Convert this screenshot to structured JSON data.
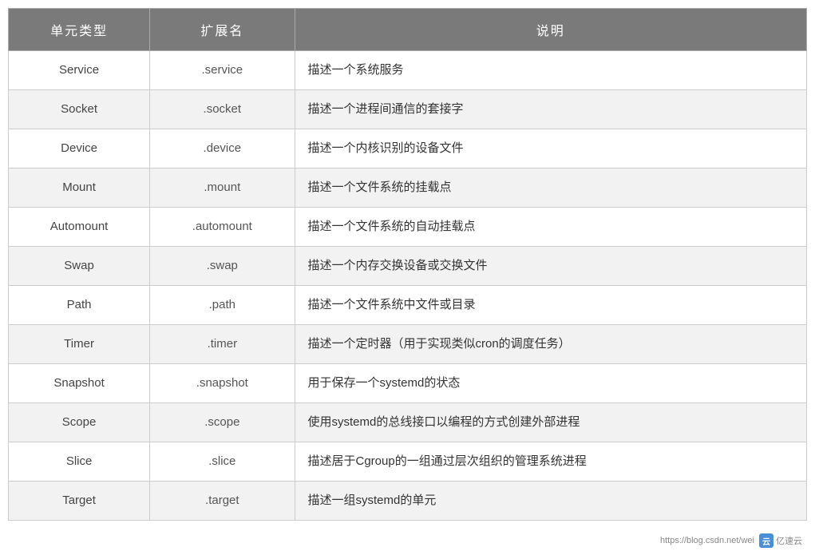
{
  "table": {
    "headers": [
      "单元类型",
      "扩展名",
      "说明"
    ],
    "rows": [
      {
        "type": "Service",
        "ext": ".service",
        "desc": "描述一个系统服务"
      },
      {
        "type": "Socket",
        "ext": ".socket",
        "desc": "描述一个进程间通信的套接字"
      },
      {
        "type": "Device",
        "ext": ".device",
        "desc": "描述一个内核识别的设备文件"
      },
      {
        "type": "Mount",
        "ext": ".mount",
        "desc": "描述一个文件系统的挂载点"
      },
      {
        "type": "Automount",
        "ext": ".automount",
        "desc": "描述一个文件系统的自动挂载点"
      },
      {
        "type": "Swap",
        "ext": ".swap",
        "desc": "描述一个内存交换设备或交换文件"
      },
      {
        "type": "Path",
        "ext": ".path",
        "desc": "描述一个文件系统中文件或目录"
      },
      {
        "type": "Timer",
        "ext": ".timer",
        "desc": "描述一个定时器（用于实现类似cron的调度任务）"
      },
      {
        "type": "Snapshot",
        "ext": ".snapshot",
        "desc": "用于保存一个systemd的状态"
      },
      {
        "type": "Scope",
        "ext": ".scope",
        "desc": "使用systemd的总线接口以编程的方式创建外部进程"
      },
      {
        "type": "Slice",
        "ext": ".slice",
        "desc": "描述居于Cgroup的一组通过层次组织的管理系统进程"
      },
      {
        "type": "Target",
        "ext": ".target",
        "desc": "描述一组systemd的单元"
      }
    ]
  },
  "watermark": {
    "url": "https://blog.csdn.net/wei",
    "logo": "亿速云"
  }
}
